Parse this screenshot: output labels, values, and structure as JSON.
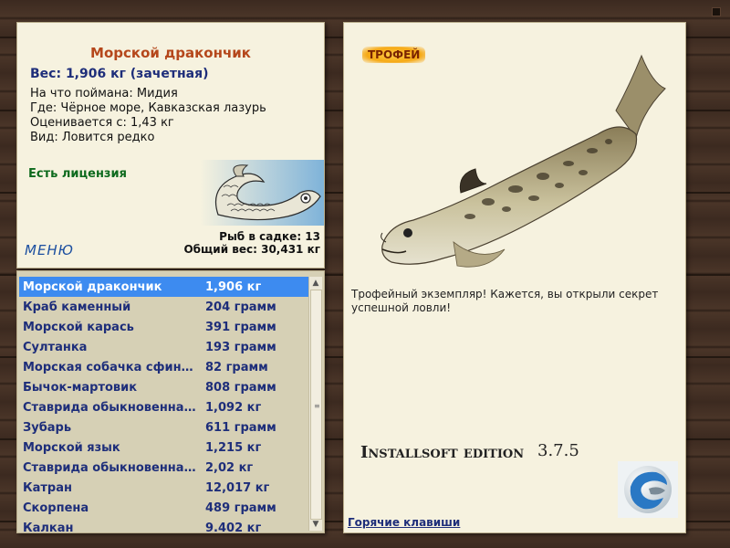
{
  "info": {
    "fish_name": "Морской дракончик",
    "weight": "Вес: 1,906 кг (зачетная)",
    "caught_on": "На что поймана: Мидия",
    "location": "Где: Чёрное море, Кавказская лазурь",
    "value": "Оценивается с: 1,43 кг",
    "kind": "Вид: Ловится редко",
    "license": "Есть лицензия",
    "menu_label": "МЕНЮ",
    "fish_in_net": "Рыб в садке: 13",
    "total_weight": "Общий вес: 30,431 кг"
  },
  "catch_list": [
    {
      "name": "Морской дракончик",
      "weight": "1,906 кг",
      "selected": true
    },
    {
      "name": "Краб каменный",
      "weight": "204 грамм"
    },
    {
      "name": "Морской карась",
      "weight": "391 грамм"
    },
    {
      "name": "Султанка",
      "weight": "193 грамм"
    },
    {
      "name": "Морская собачка сфин…",
      "weight": "82 грамм"
    },
    {
      "name": "Бычок-мартовик",
      "weight": "808 грамм"
    },
    {
      "name": "Ставрида обыкновенна…",
      "weight": "1,092 кг"
    },
    {
      "name": "Зубарь",
      "weight": "611 грамм"
    },
    {
      "name": "Морской язык",
      "weight": "1,215 кг"
    },
    {
      "name": "Ставрида обыкновенна…",
      "weight": "2,02 кг"
    },
    {
      "name": "Катран",
      "weight": "12,017 кг"
    },
    {
      "name": "Скорпена",
      "weight": "489 грамм"
    },
    {
      "name": "Калкан",
      "weight": "9.402 кг"
    }
  ],
  "detail": {
    "trophy_label": "ТРОФЕЙ",
    "description": "Трофейный экземпляр! Кажется, вы открыли секрет успешной ловли!",
    "edition": "Installsoft edition",
    "version": "3.7.5",
    "hotkeys": "Горячие клавиши"
  },
  "colors": {
    "title": "#b5471b",
    "list_text": "#1e2e7a",
    "selected_row": "#3d8bf0",
    "license": "#0d6a1d"
  },
  "icons": [
    "scroll-up-icon",
    "scroll-down-icon",
    "app-logo-icon"
  ]
}
